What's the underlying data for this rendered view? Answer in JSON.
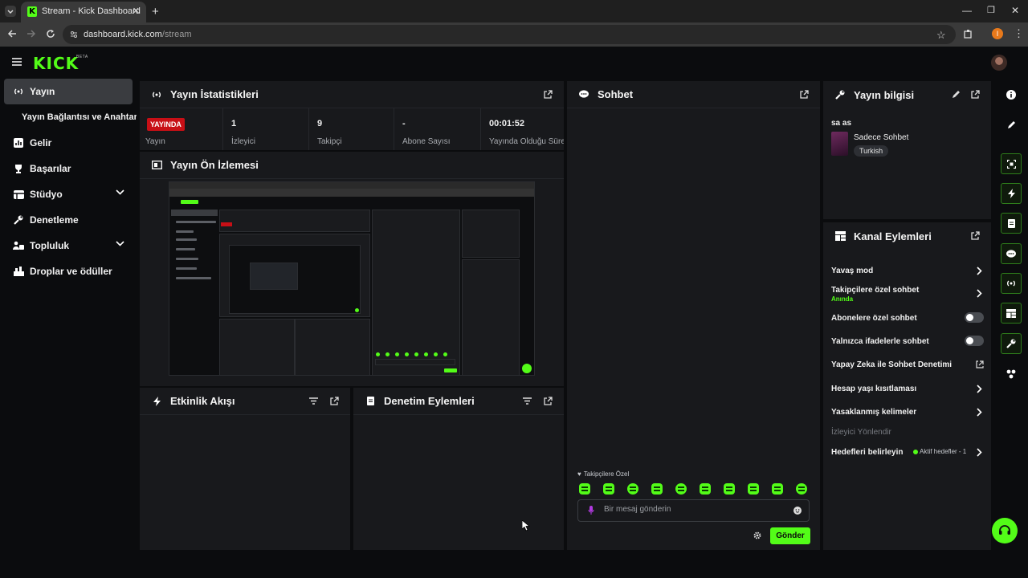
{
  "browser": {
    "tab_title": "Stream - Kick Dashboard",
    "url_domain": "dashboard.kick.com",
    "url_path": "/stream",
    "profile_initial": "I"
  },
  "header": {
    "logo": "KICK",
    "beta": "BETA"
  },
  "sidebar": {
    "items": [
      {
        "label": "Yayın",
        "icon": "broadcast-icon"
      },
      {
        "label": "Yayın Bağlantısı ve Anahtarı",
        "icon": ""
      },
      {
        "label": "Gelir",
        "icon": "chart-icon"
      },
      {
        "label": "Başarılar",
        "icon": "trophy-icon"
      },
      {
        "label": "Stüdyo",
        "icon": "studio-icon"
      },
      {
        "label": "Denetleme",
        "icon": "wrench-icon"
      },
      {
        "label": "Topluluk",
        "icon": "people-icon"
      },
      {
        "label": "Droplar ve ödüller",
        "icon": "drops-icon"
      }
    ]
  },
  "stats": {
    "title": "Yayın İstatistikleri",
    "live_badge": "YAYINDA",
    "live_label": "Yayın",
    "viewers_value": "1",
    "viewers_label": "İzleyici",
    "followers_value": "9",
    "followers_label": "Takipçi",
    "subs_value": "-",
    "subs_label": "Abone Sayısı",
    "uptime_value": "00:01:52",
    "uptime_label": "Yayında Olduğu Süre"
  },
  "preview": {
    "title": "Yayın Ön İzlemesi"
  },
  "activity": {
    "title": "Etkinlik Akışı"
  },
  "moderation": {
    "title": "Denetim Eylemleri"
  },
  "chat": {
    "title": "Sohbet",
    "followers_only_label": "Takipçilere Özel",
    "input_placeholder": "Bir mesaj gönderin",
    "send_label": "Gönder"
  },
  "stream_info": {
    "title": "Yayın bilgisi",
    "stream_title": "sa as",
    "category": "Sadece Sohbet",
    "language": "Turkish"
  },
  "channel_actions": {
    "title": "Kanal Eylemleri",
    "slow_mode": "Yavaş mod",
    "followers_chat": "Takipçilere özel sohbet",
    "followers_chat_sub": "Anında",
    "subs_chat": "Abonelere özel sohbet",
    "emote_chat": "Yalnızca ifadelerle sohbet",
    "ai_moderation": "Yapay Zeka ile Sohbet Denetimi",
    "age_restriction": "Hesap yaşı kısıtlaması",
    "banned_words": "Yasaklanmış kelimeler",
    "viewer_redirect": "İzleyici Yönlendir",
    "goals": "Hedefleri belirleyin",
    "goals_status": "Aktif hedefler - 1"
  },
  "colors": {
    "brand": "#53fc18",
    "live": "#c80f16",
    "panel": "#18191c",
    "background": "#0b0c0e"
  }
}
